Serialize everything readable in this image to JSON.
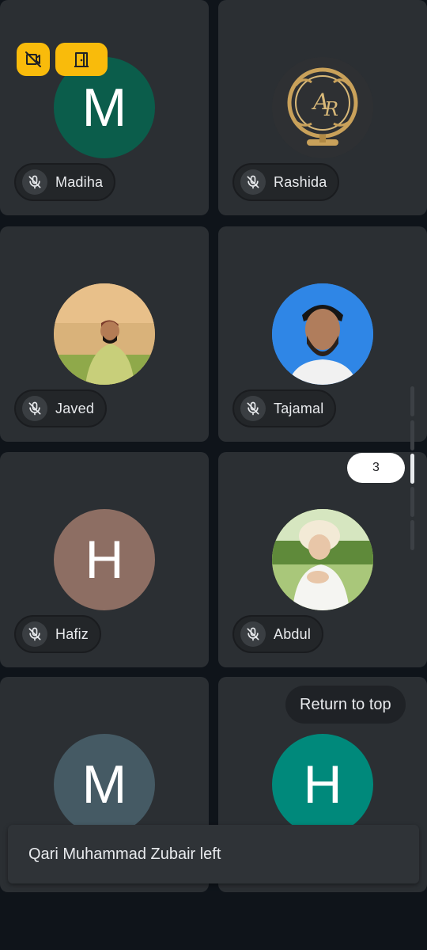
{
  "participants": [
    {
      "name": "Madiha",
      "initial": "M",
      "color": "#0b5d4b",
      "muted": true
    },
    {
      "name": "Rashida",
      "initial": "",
      "color": "#2d3134",
      "muted": true,
      "photo": "gold-monogram-ar"
    },
    {
      "name": "Javed",
      "initial": "",
      "color": "#c79b5a",
      "muted": true,
      "photo": "man-in-field"
    },
    {
      "name": "Tajamal",
      "initial": "",
      "color": "#3b8ee8",
      "muted": true,
      "photo": "man-blue-background"
    },
    {
      "name": "Hafiz",
      "initial": "H",
      "color": "#8d6e63",
      "muted": true
    },
    {
      "name": "Abdul",
      "initial": "",
      "color": "#8fae5a",
      "muted": true,
      "photo": "child-outdoors"
    },
    {
      "name": "",
      "initial": "M",
      "color": "#455a64",
      "muted": false
    },
    {
      "name": "",
      "initial": "H",
      "color": "#00897b",
      "muted": false
    }
  ],
  "status_badges": [
    "no-camera-icon",
    "exit-door-icon"
  ],
  "page_indicator": "3",
  "return_to_top": "Return to top",
  "toast_message": "Qari Muhammad Zubair left",
  "colors": {
    "background": "#0f141a",
    "tile": "#2b2f33",
    "badge": "#f9bb0b"
  }
}
